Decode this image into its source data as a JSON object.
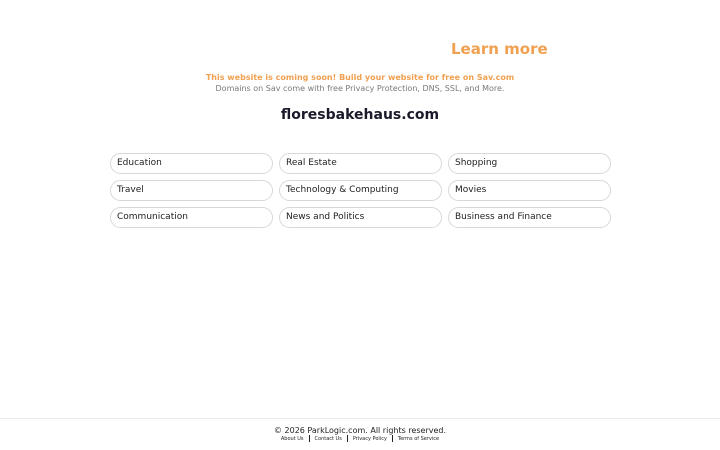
{
  "header": {
    "learn_more_label": "Learn more"
  },
  "promo": {
    "headline": "This website is coming soon! Build your website for free on Sav.com",
    "subtext": "Domains on Sav come with free Privacy Protection, DNS, SSL, and More."
  },
  "domain_name": "floresbakehaus.com",
  "categories": [
    "Education",
    "Real Estate",
    "Shopping",
    "Travel",
    "Technology & Computing",
    "Movies",
    "Communication",
    "News and Politics",
    "Business and Finance"
  ],
  "footer": {
    "copyright": "© 2026 ParkLogic.com. All rights reserved.",
    "links": [
      "About Us",
      "Contact Us",
      "Privacy Policy",
      "Terms of Service"
    ]
  },
  "colors": {
    "accent": "#f0a050",
    "muted_text": "#7a7a7a",
    "pill_border": "#d8d8d8"
  }
}
